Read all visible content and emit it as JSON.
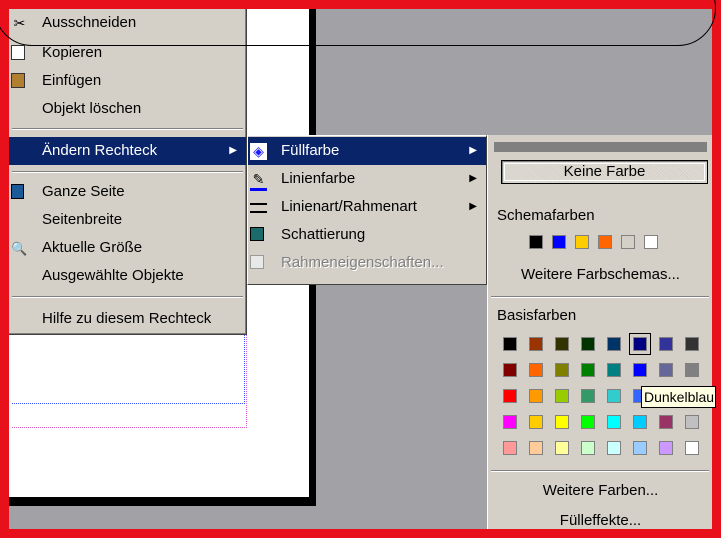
{
  "context_menu": {
    "items": [
      {
        "label": "Ausschneiden",
        "icon": "scissors-icon"
      },
      {
        "label": "Kopieren",
        "icon": "copy-icon"
      },
      {
        "label": "Einfügen",
        "icon": "paste-icon"
      },
      {
        "label": "Objekt löschen"
      },
      {
        "label": "Ändern Rechteck",
        "submenu": true
      },
      {
        "label": "Ganze Seite",
        "icon": "page-icon"
      },
      {
        "label": "Seitenbreite"
      },
      {
        "label": "Aktuelle Größe",
        "icon": "zoom-icon"
      },
      {
        "label": "Ausgewählte Objekte"
      },
      {
        "label": "Hilfe zu diesem Rechteck"
      }
    ]
  },
  "submenu": {
    "items": [
      {
        "label": "Füllfarbe",
        "icon": "paint-bucket-icon",
        "submenu": true
      },
      {
        "label": "Linienfarbe",
        "icon": "pen-icon",
        "submenu": true
      },
      {
        "label": "Linienart/Rahmenart",
        "icon": "line-style-icon",
        "submenu": true
      },
      {
        "label": "Schattierung",
        "icon": "shadow-icon"
      },
      {
        "label": "Rahmeneigenschaften...",
        "icon": "properties-icon",
        "disabled": true
      }
    ]
  },
  "color_palette": {
    "no_color": "Keine Farbe",
    "scheme_label": "Schemafarben",
    "scheme_colors": [
      "#000000",
      "#0000ff",
      "#ffcc00",
      "#ff6600",
      "#d4d0c8",
      "#ffffff"
    ],
    "more_schemes": "Weitere Farbschemas...",
    "basic_label": "Basisfarben",
    "basic_colors": [
      [
        "#000000",
        "#993300",
        "#333300",
        "#003300",
        "#003366",
        "#000080",
        "#333399",
        "#333333"
      ],
      [
        "#800000",
        "#ff6600",
        "#808000",
        "#008000",
        "#008080",
        "#0000ff",
        "#666699",
        "#808080"
      ],
      [
        "#ff0000",
        "#ff9900",
        "#99cc00",
        "#339966",
        "#33cccc",
        "#3366ff",
        "#800080",
        "#969696"
      ],
      [
        "#ff00ff",
        "#ffcc00",
        "#ffff00",
        "#00ff00",
        "#00ffff",
        "#00ccff",
        "#993366",
        "#c0c0c0"
      ],
      [
        "#ff9999",
        "#ffcc99",
        "#ffff99",
        "#ccffcc",
        "#ccffff",
        "#99ccff",
        "#cc99ff",
        "#ffffff"
      ]
    ],
    "selected_color": "#000080",
    "tooltip": "Dunkelblau",
    "more_colors": "Weitere Farben...",
    "fill_effects": "Fülleffekte..."
  }
}
